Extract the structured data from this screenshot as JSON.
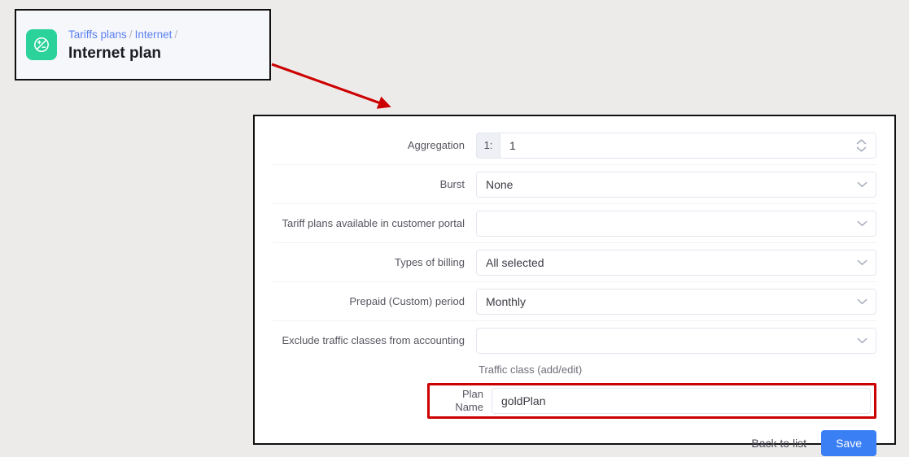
{
  "header": {
    "icon": "plus-minus-circle-icon",
    "icon_bg": "#2bd39a",
    "breadcrumb": [
      {
        "label": "Tariffs plans",
        "type": "link"
      },
      {
        "label": "/",
        "type": "separator"
      },
      {
        "label": "Internet",
        "type": "link"
      },
      {
        "label": "/",
        "type": "separator"
      }
    ],
    "title": "Internet plan",
    "link_color": "#5b80f0"
  },
  "annotation": {
    "arrow_color": "#cc0000",
    "highlight_color": "#cc0000",
    "arrow_name": "red-pointer-arrow"
  },
  "form": {
    "rows": [
      {
        "label": "Aggregation",
        "control": "number-group",
        "addon": "1:",
        "value": "1",
        "placeholder": "",
        "spinner": true
      },
      {
        "label": "Burst",
        "control": "select",
        "value": "None",
        "placeholder": ""
      },
      {
        "label": "Tariff plans available in customer portal",
        "control": "select",
        "value": "",
        "placeholder": ""
      },
      {
        "label": "Types of billing",
        "control": "select",
        "value": "All selected",
        "placeholder": ""
      },
      {
        "label": "Prepaid (Custom) period",
        "control": "select",
        "value": "Monthly",
        "placeholder": ""
      },
      {
        "label": "Exclude traffic classes from accounting",
        "control": "select",
        "value": "",
        "placeholder": ""
      }
    ],
    "helper_text": "Traffic class (add/edit)",
    "plan_name": {
      "label": "Plan Name",
      "value": "goldPlan",
      "placeholder": ""
    },
    "footer": {
      "back_label": "Back to list",
      "save_label": "Save",
      "save_color": "#3b7ff5"
    }
  }
}
